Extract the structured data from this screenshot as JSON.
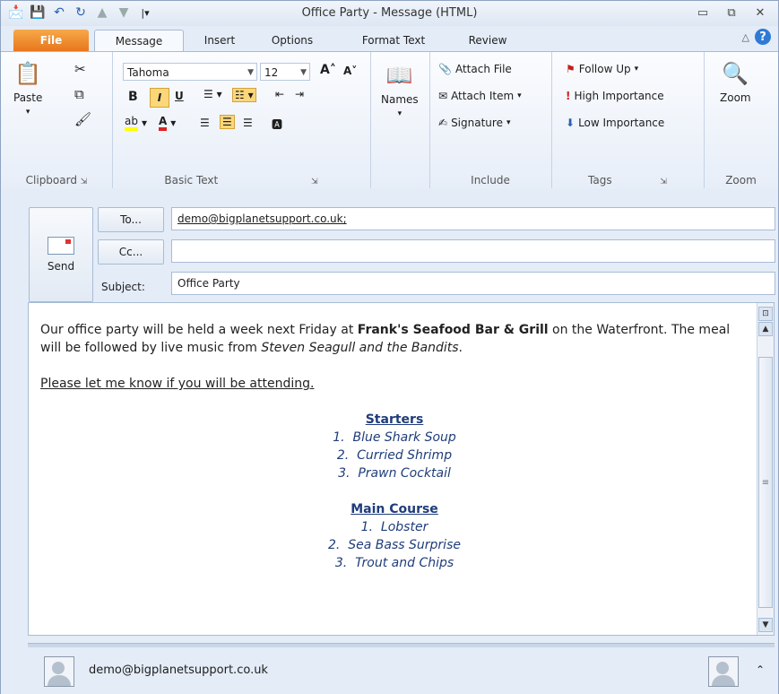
{
  "window": {
    "title": "Office Party - Message (HTML)"
  },
  "tabs": [
    "File",
    "Message",
    "Insert",
    "Options",
    "Format Text",
    "Review"
  ],
  "ribbon": {
    "clipboard": {
      "label": "Clipboard",
      "paste": "Paste"
    },
    "basic_text": {
      "label": "Basic Text",
      "font": "Tahoma",
      "size": "12"
    },
    "names": {
      "label": "Names"
    },
    "include": {
      "label": "Include",
      "attach_file": "Attach File",
      "attach_item": "Attach Item",
      "signature": "Signature"
    },
    "tags": {
      "label": "Tags",
      "follow_up": "Follow Up",
      "high": "High Importance",
      "low": "Low Importance"
    },
    "zoom": {
      "label": "Zoom",
      "button": "Zoom"
    }
  },
  "compose": {
    "send": "Send",
    "to_button": "To...",
    "cc_button": "Cc...",
    "subject_label": "Subject:",
    "to_value": "demo@bigplanetsupport.co.uk;",
    "cc_value": "",
    "subject_value": "Office Party"
  },
  "message": {
    "p1_a": "Our office party will be held a week next Friday at ",
    "p1_bold": "Frank's Seafood Bar & Grill",
    "p1_b": " on the Waterfront. The meal will be followed by live music from ",
    "p1_italic": "Steven Seagull and the Bandits",
    "p1_c": ".",
    "p2": "Please let me know if you will be attending.",
    "starters_heading": "Starters",
    "starters": [
      "Blue Shark Soup",
      "Curried Shrimp",
      "Prawn Cocktail"
    ],
    "main_heading": "Main Course",
    "main": [
      "Lobster",
      "Sea Bass Surprise",
      "Trout and Chips"
    ]
  },
  "people_pane": {
    "email": "demo@bigplanetsupport.co.uk"
  },
  "colors": {
    "file_tab": "#e8761c",
    "accent": "#2f7ad6",
    "menu_text": "#1f3d7a"
  }
}
